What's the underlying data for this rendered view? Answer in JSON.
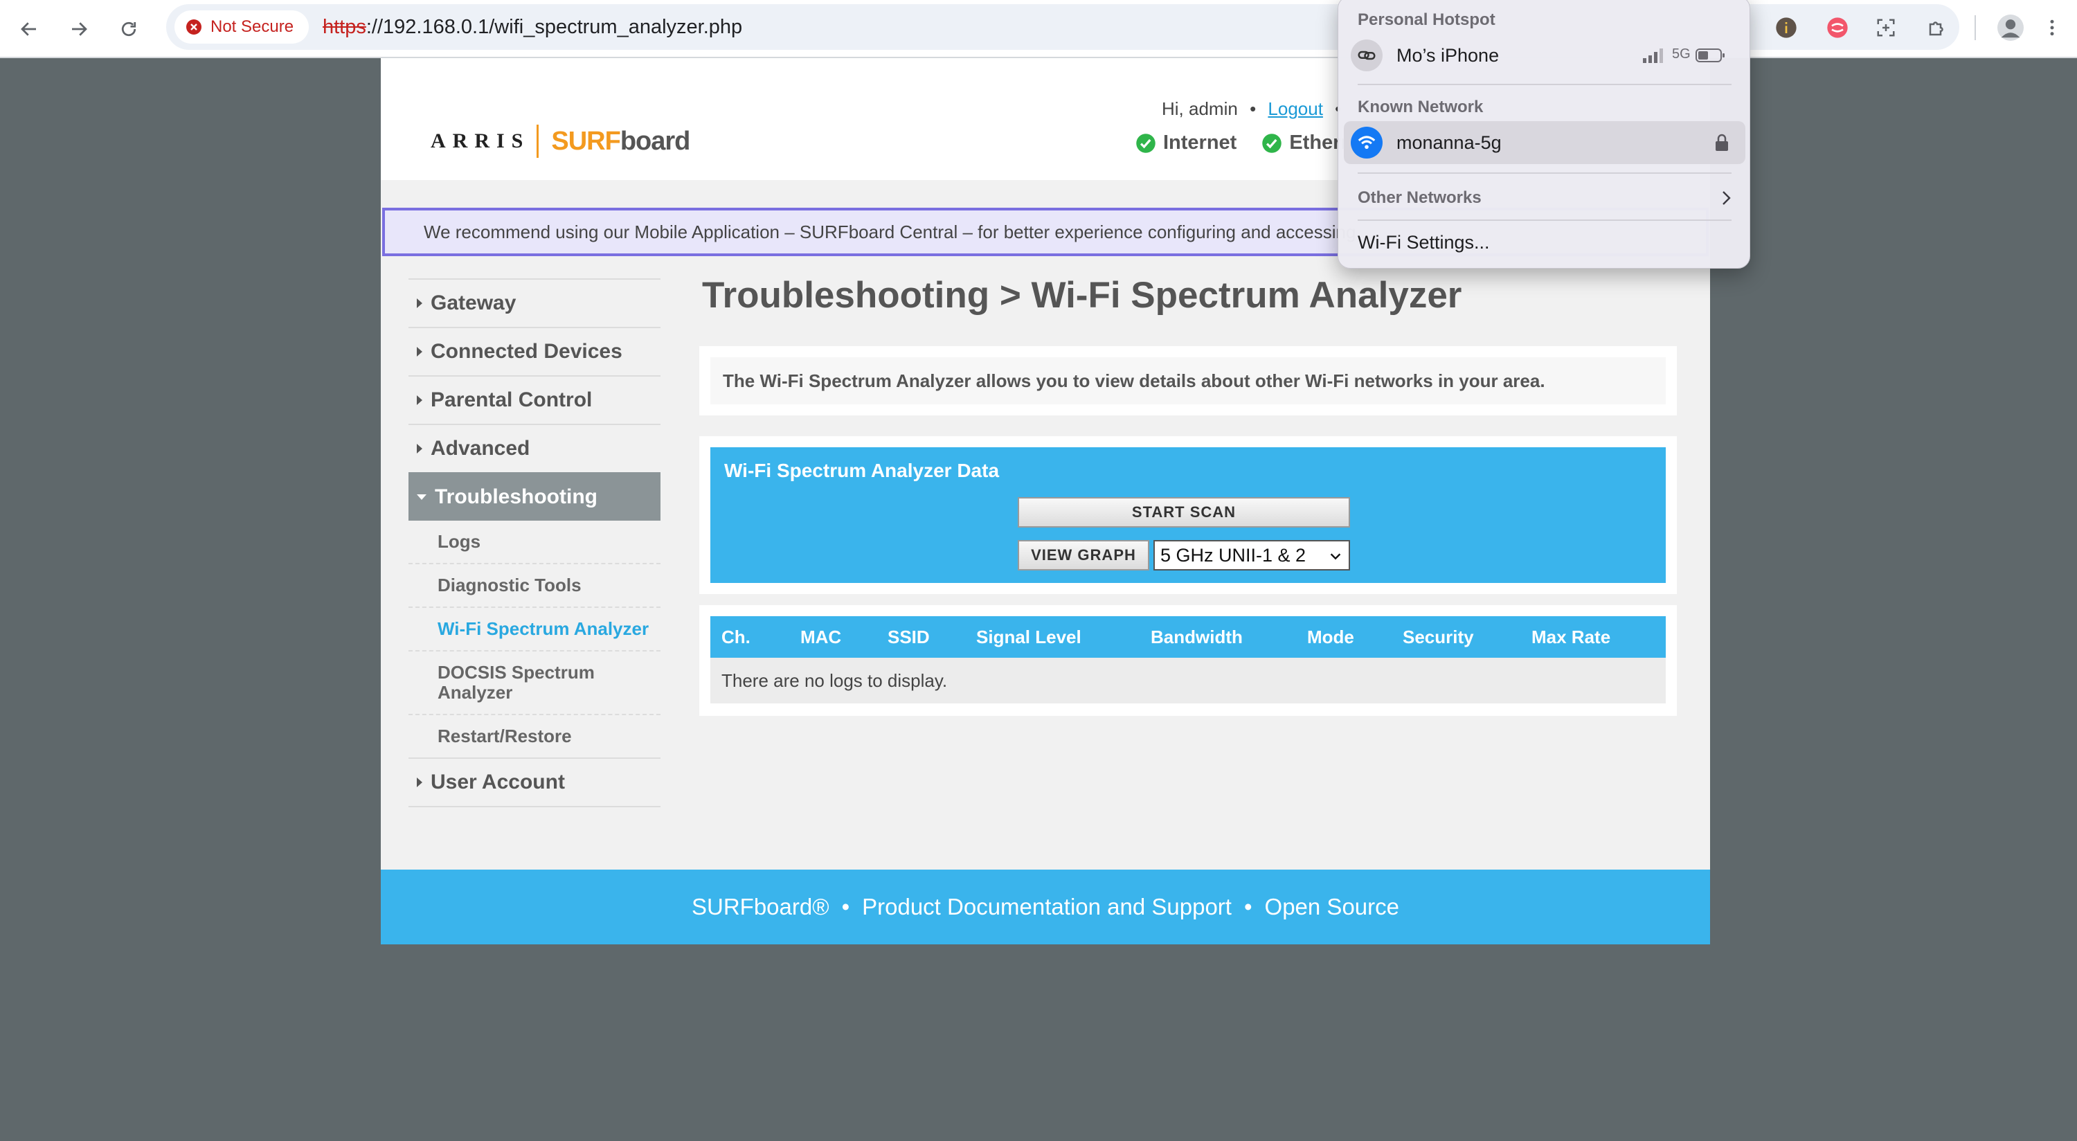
{
  "browser": {
    "security_label": "Not Secure",
    "url_scheme": "https",
    "url_rest": "://192.168.0.1/wifi_spectrum_analyzer.php"
  },
  "header": {
    "logo_arris": "ARRIS",
    "logo_surf": "SURF",
    "logo_board": "board",
    "greeting": "Hi, admin",
    "separator": "•",
    "logout": "Logout",
    "status_internet": "Internet",
    "status_ethernet": "Ethern"
  },
  "banner": {
    "text": "We recommend using our Mobile Application – SURFboard Central – for better experience configuring and accessing"
  },
  "sidebar": {
    "gateway": "Gateway",
    "connected_devices": "Connected Devices",
    "parental_control": "Parental Control",
    "advanced": "Advanced",
    "troubleshooting": "Troubleshooting",
    "logs": "Logs",
    "diagnostic_tools": "Diagnostic Tools",
    "wifi_spectrum": "Wi-Fi Spectrum Analyzer",
    "docsis_line1": "DOCSIS Spectrum",
    "docsis_line2": "Analyzer",
    "restart": "Restart/Restore",
    "user_account": "User Account"
  },
  "main": {
    "title": "Troubleshooting > Wi-Fi Spectrum Analyzer",
    "description": "The Wi-Fi Spectrum Analyzer allows you to view details about other Wi-Fi networks in your area.",
    "analyzer_title": "Wi-Fi Spectrum Analyzer Data",
    "start_scan": "START SCAN",
    "view_graph": "VIEW GRAPH",
    "band_selected": "5 GHz UNII-1 & 2",
    "columns": [
      "Ch.",
      "MAC",
      "SSID",
      "Signal Level",
      "Bandwidth",
      "Mode",
      "Security",
      "Max Rate"
    ],
    "empty": "There are no logs to display."
  },
  "footer": {
    "surfboard": "SURFboard®",
    "dot": "•",
    "docs": "Product Documentation and Support",
    "open_source": "Open Source"
  },
  "wifi_menu": {
    "personal_hotspot": "Personal Hotspot",
    "hotspot_device": "Mo’s iPhone",
    "hotspot_band": "5G",
    "known_network": "Known Network",
    "known_ssid": "monanna-5g",
    "other_networks": "Other Networks",
    "wifi_settings": "Wi-Fi Settings..."
  },
  "colors": {
    "accent_blue": "#3ab4ec",
    "surf_orange": "#f39a1f",
    "status_green": "#2fb54a",
    "warning_red": "#c5221f"
  }
}
